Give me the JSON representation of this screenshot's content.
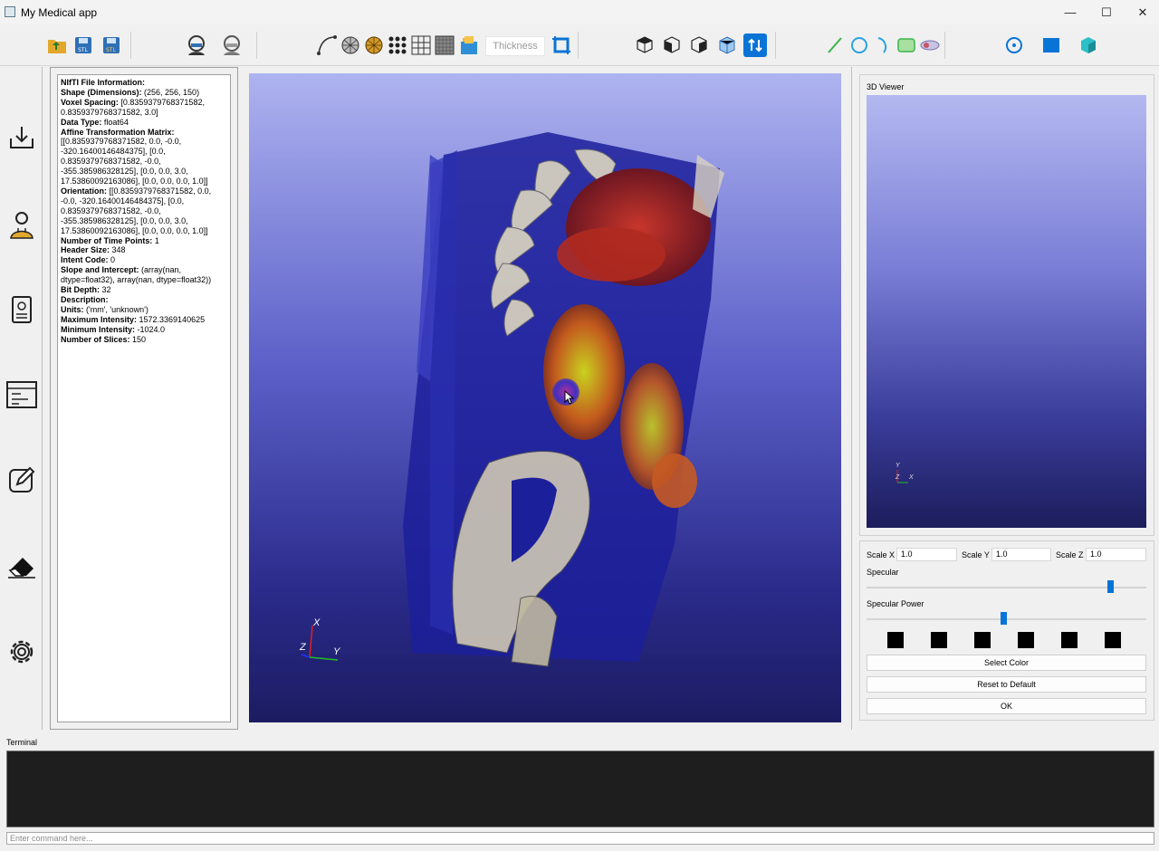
{
  "window": {
    "title": "My Medical app",
    "minimize": "—",
    "maximize": "☐",
    "close": "✕"
  },
  "toolbar": {
    "thickness_placeholder": "Thickness"
  },
  "info": {
    "title": "NIfTI File Information:",
    "rows": [
      {
        "k": "Shape (Dimensions):",
        "v": " (256, 256, 150)"
      },
      {
        "k": "Voxel Spacing:",
        "v": " [0.8359379768371582, 0.8359379768371582, 3.0]"
      },
      {
        "k": "Data Type:",
        "v": " float64"
      },
      {
        "k": "Affine Transformation Matrix:",
        "v": " [[0.8359379768371582, 0.0, -0.0, -320.16400146484375], [0.0, 0.8359379768371582, -0.0, -355.385986328125], [0.0, 0.0, 3.0, 17.53860092163086], [0.0, 0.0, 0.0, 1.0]]"
      },
      {
        "k": "Orientation:",
        "v": " [[0.8359379768371582, 0.0, -0.0, -320.16400146484375], [0.0, 0.8359379768371582, -0.0, -355.385986328125], [0.0, 0.0, 3.0, 17.53860092163086], [0.0, 0.0, 0.0, 1.0]]"
      },
      {
        "k": "Number of Time Points:",
        "v": " 1"
      },
      {
        "k": "Header Size:",
        "v": " 348"
      },
      {
        "k": "Intent Code:",
        "v": " 0"
      },
      {
        "k": "Slope and Intercept:",
        "v": " (array(nan, dtype=float32), array(nan, dtype=float32))"
      },
      {
        "k": "Bit Depth:",
        "v": " 32"
      },
      {
        "k": "Description:",
        "v": ""
      },
      {
        "k": "Units:",
        "v": " ('mm', 'unknown')"
      },
      {
        "k": "Maximum Intensity:",
        "v": " 1572.3369140625"
      },
      {
        "k": "Minimum Intensity:",
        "v": " -1024.0"
      },
      {
        "k": "Number of Slices:",
        "v": " 150"
      }
    ]
  },
  "viewer": {
    "axis_x": "X",
    "axis_y": "Y",
    "axis_z": "Z"
  },
  "viewer3d": {
    "label": "3D Viewer",
    "axis_x": "X",
    "axis_y": "Y",
    "axis_z": "Z"
  },
  "props": {
    "scale_x_label": "Scale X",
    "scale_x": "1.0",
    "scale_y_label": "Scale Y",
    "scale_y": "1.0",
    "scale_z_label": "Scale Z",
    "scale_z": "1.0",
    "specular_label": "Specular",
    "specular_level": 0.88,
    "specular_power_label": "Specular Power",
    "specular_power_level": 0.49,
    "swatch_color": "#000000",
    "select_color": "Select Color",
    "reset": "Reset to Default",
    "ok": "OK"
  },
  "terminal": {
    "label": "Terminal",
    "placeholder": "Enter command here..."
  },
  "colors": {
    "accent": "#0a74d6",
    "terminal_bg": "#1e1e1e"
  }
}
